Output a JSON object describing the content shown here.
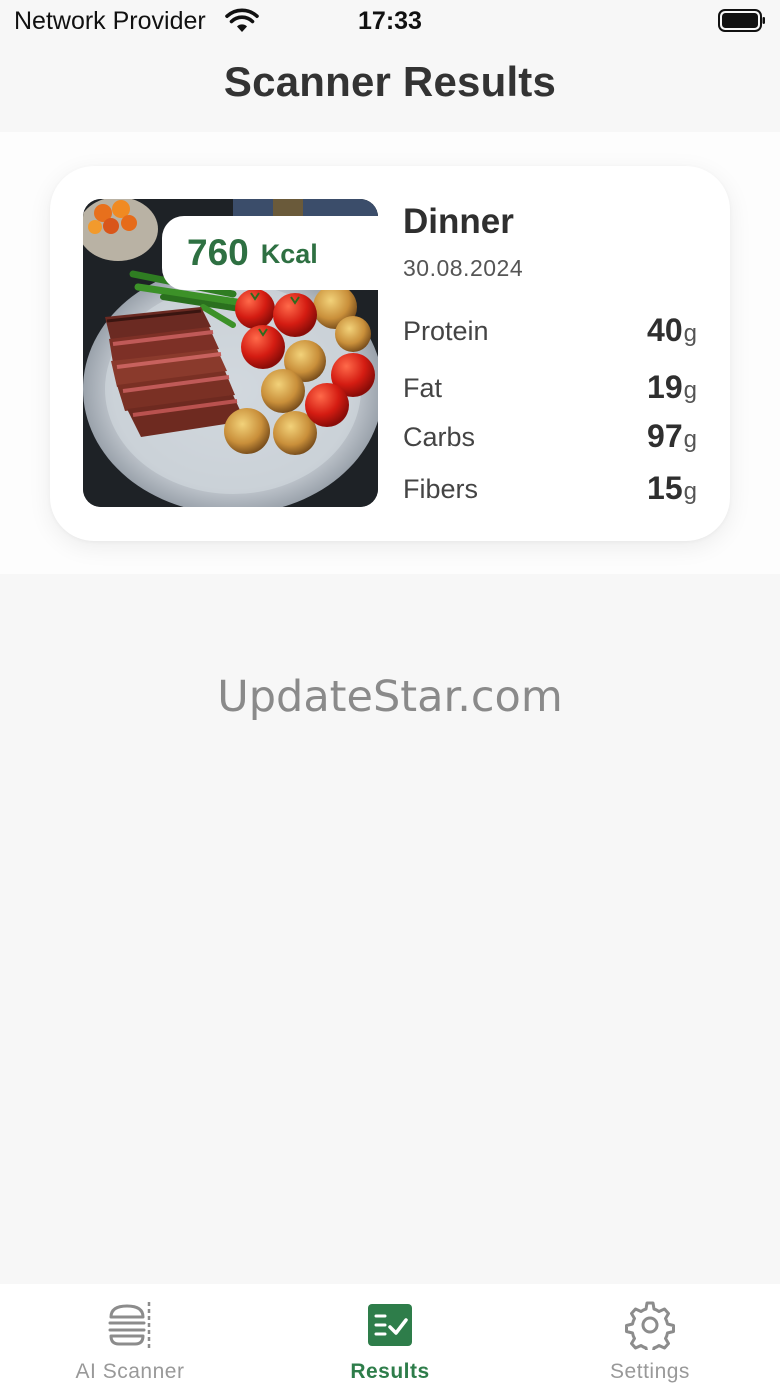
{
  "status_bar": {
    "carrier": "Network Provider",
    "time": "17:33",
    "icons": [
      "wifi-icon",
      "battery-icon"
    ]
  },
  "page_title": "Scanner Results",
  "result_card": {
    "calories_value": "760",
    "calories_unit": "Kcal",
    "meal_name": "Dinner",
    "date": "30.08.2024",
    "nutrients": [
      {
        "label": "Protein",
        "value": "40",
        "unit": "g"
      },
      {
        "label": "Fat",
        "value": "19",
        "unit": "g"
      },
      {
        "label": "Carbs",
        "value": "97",
        "unit": "g"
      },
      {
        "label": "Fibers",
        "value": "15",
        "unit": "g"
      }
    ],
    "image_icon": "food-photo-steak-tomatoes-potatoes"
  },
  "watermark": "UpdateStar.com",
  "tab_bar": {
    "tabs": [
      {
        "label": "AI Scanner",
        "icon": "burger-scan-icon",
        "active": false
      },
      {
        "label": "Results",
        "icon": "results-checklist-icon",
        "active": true
      },
      {
        "label": "Settings",
        "icon": "gear-icon",
        "active": false
      }
    ]
  },
  "colors": {
    "accent": "#2e7d4a",
    "calorie_text": "#2e7042",
    "background": "#f7f7f7",
    "card": "#ffffff",
    "inactive_tab": "#999999"
  }
}
